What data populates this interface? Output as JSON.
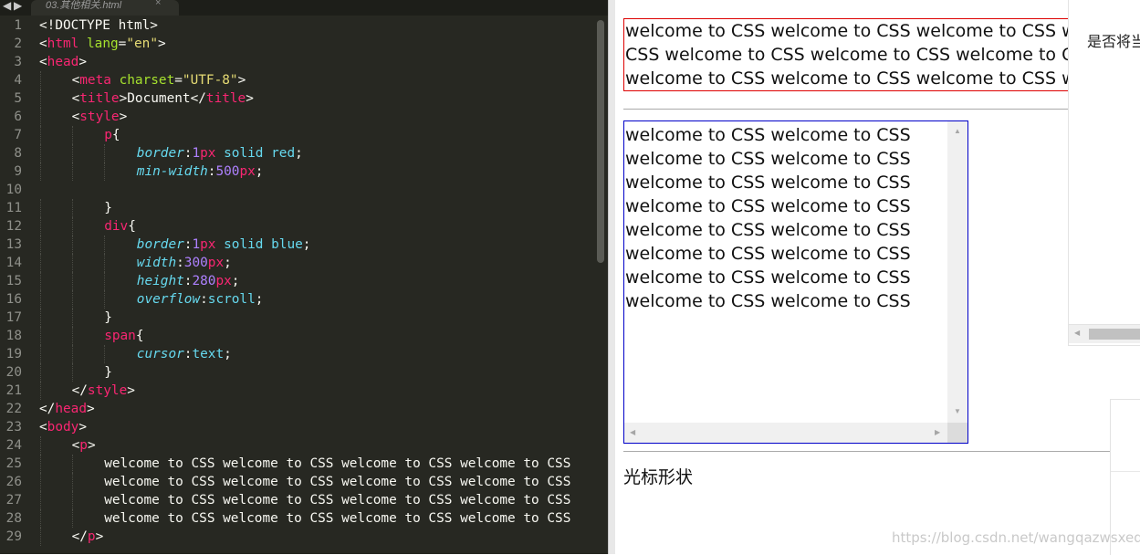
{
  "editor": {
    "tab": {
      "filename": "03.其他相关.html",
      "close_glyph": "×"
    },
    "nav": {
      "back": "◀",
      "forward": "▶"
    },
    "lines": [
      {
        "num": "1",
        "indent": 0,
        "tokens": [
          {
            "c": "x",
            "t": "<!DOCTYPE html>"
          }
        ]
      },
      {
        "num": "2",
        "indent": 0,
        "tokens": [
          {
            "c": "x",
            "t": "<"
          },
          {
            "c": "t",
            "t": "html"
          },
          {
            "c": "x",
            "t": " "
          },
          {
            "c": "a",
            "t": "lang"
          },
          {
            "c": "x",
            "t": "="
          },
          {
            "c": "s",
            "t": "\"en\""
          },
          {
            "c": "x",
            "t": ">"
          }
        ]
      },
      {
        "num": "3",
        "indent": 0,
        "tokens": [
          {
            "c": "x",
            "t": "<"
          },
          {
            "c": "t",
            "t": "head"
          },
          {
            "c": "x",
            "t": ">"
          }
        ]
      },
      {
        "num": "4",
        "indent": 1,
        "tokens": [
          {
            "c": "x",
            "t": "<"
          },
          {
            "c": "t",
            "t": "meta"
          },
          {
            "c": "x",
            "t": " "
          },
          {
            "c": "a",
            "t": "charset"
          },
          {
            "c": "x",
            "t": "="
          },
          {
            "c": "s",
            "t": "\"UTF-8\""
          },
          {
            "c": "x",
            "t": ">"
          }
        ]
      },
      {
        "num": "5",
        "indent": 1,
        "tokens": [
          {
            "c": "x",
            "t": "<"
          },
          {
            "c": "t",
            "t": "title"
          },
          {
            "c": "x",
            "t": ">Document</"
          },
          {
            "c": "t",
            "t": "title"
          },
          {
            "c": "x",
            "t": ">"
          }
        ]
      },
      {
        "num": "6",
        "indent": 1,
        "tokens": [
          {
            "c": "x",
            "t": "<"
          },
          {
            "c": "t",
            "t": "style"
          },
          {
            "c": "x",
            "t": ">"
          }
        ]
      },
      {
        "num": "7",
        "indent": 2,
        "tokens": [
          {
            "c": "t",
            "t": "p"
          },
          {
            "c": "x",
            "t": "{"
          }
        ]
      },
      {
        "num": "8",
        "indent": 3,
        "tokens": [
          {
            "c": "p",
            "t": "border"
          },
          {
            "c": "x",
            "t": ":"
          },
          {
            "c": "n",
            "t": "1"
          },
          {
            "c": "t",
            "t": "px"
          },
          {
            "c": "x",
            "t": " "
          },
          {
            "c": "v",
            "t": "solid"
          },
          {
            "c": "x",
            "t": " "
          },
          {
            "c": "v",
            "t": "red"
          },
          {
            "c": "x",
            "t": ";"
          }
        ]
      },
      {
        "num": "9",
        "indent": 3,
        "tokens": [
          {
            "c": "p",
            "t": "min-width"
          },
          {
            "c": "x",
            "t": ":"
          },
          {
            "c": "n",
            "t": "500"
          },
          {
            "c": "t",
            "t": "px"
          },
          {
            "c": "x",
            "t": ";"
          }
        ]
      },
      {
        "num": "10",
        "indent": 0,
        "tokens": []
      },
      {
        "num": "11",
        "indent": 2,
        "tokens": [
          {
            "c": "x",
            "t": "}"
          }
        ]
      },
      {
        "num": "12",
        "indent": 2,
        "tokens": [
          {
            "c": "t",
            "t": "div"
          },
          {
            "c": "x",
            "t": "{"
          }
        ]
      },
      {
        "num": "13",
        "indent": 3,
        "tokens": [
          {
            "c": "p",
            "t": "border"
          },
          {
            "c": "x",
            "t": ":"
          },
          {
            "c": "n",
            "t": "1"
          },
          {
            "c": "t",
            "t": "px"
          },
          {
            "c": "x",
            "t": " "
          },
          {
            "c": "v",
            "t": "solid"
          },
          {
            "c": "x",
            "t": " "
          },
          {
            "c": "v",
            "t": "blue"
          },
          {
            "c": "x",
            "t": ";"
          }
        ]
      },
      {
        "num": "14",
        "indent": 3,
        "tokens": [
          {
            "c": "p",
            "t": "width"
          },
          {
            "c": "x",
            "t": ":"
          },
          {
            "c": "n",
            "t": "300"
          },
          {
            "c": "t",
            "t": "px"
          },
          {
            "c": "x",
            "t": ";"
          }
        ]
      },
      {
        "num": "15",
        "indent": 3,
        "tokens": [
          {
            "c": "p",
            "t": "height"
          },
          {
            "c": "x",
            "t": ":"
          },
          {
            "c": "n",
            "t": "280"
          },
          {
            "c": "t",
            "t": "px"
          },
          {
            "c": "x",
            "t": ";"
          }
        ]
      },
      {
        "num": "16",
        "indent": 3,
        "tokens": [
          {
            "c": "p",
            "t": "overflow"
          },
          {
            "c": "x",
            "t": ":"
          },
          {
            "c": "v",
            "t": "scroll"
          },
          {
            "c": "x",
            "t": ";"
          }
        ]
      },
      {
        "num": "17",
        "indent": 2,
        "tokens": [
          {
            "c": "x",
            "t": "}"
          }
        ]
      },
      {
        "num": "18",
        "indent": 2,
        "tokens": [
          {
            "c": "t",
            "t": "span"
          },
          {
            "c": "x",
            "t": "{"
          }
        ]
      },
      {
        "num": "19",
        "indent": 3,
        "tokens": [
          {
            "c": "p",
            "t": "cursor"
          },
          {
            "c": "x",
            "t": ":"
          },
          {
            "c": "v",
            "t": "text"
          },
          {
            "c": "x",
            "t": ";"
          }
        ]
      },
      {
        "num": "20",
        "indent": 2,
        "tokens": [
          {
            "c": "x",
            "t": "}"
          }
        ]
      },
      {
        "num": "21",
        "indent": 1,
        "tokens": [
          {
            "c": "x",
            "t": "</"
          },
          {
            "c": "t",
            "t": "style"
          },
          {
            "c": "x",
            "t": ">"
          }
        ]
      },
      {
        "num": "22",
        "indent": 0,
        "tokens": [
          {
            "c": "x",
            "t": "</"
          },
          {
            "c": "t",
            "t": "head"
          },
          {
            "c": "x",
            "t": ">"
          }
        ]
      },
      {
        "num": "23",
        "indent": 0,
        "tokens": [
          {
            "c": "x",
            "t": "<"
          },
          {
            "c": "t",
            "t": "body"
          },
          {
            "c": "x",
            "t": ">"
          }
        ]
      },
      {
        "num": "24",
        "indent": 1,
        "tokens": [
          {
            "c": "x",
            "t": "<"
          },
          {
            "c": "t",
            "t": "p"
          },
          {
            "c": "x",
            "t": ">"
          }
        ]
      },
      {
        "num": "25",
        "indent": 2,
        "tokens": [
          {
            "c": "x",
            "t": "welcome to CSS welcome to CSS welcome to CSS welcome to CSS"
          }
        ]
      },
      {
        "num": "26",
        "indent": 2,
        "tokens": [
          {
            "c": "x",
            "t": "welcome to CSS welcome to CSS welcome to CSS welcome to CSS"
          }
        ]
      },
      {
        "num": "27",
        "indent": 2,
        "tokens": [
          {
            "c": "x",
            "t": "welcome to CSS welcome to CSS welcome to CSS welcome to CSS"
          }
        ]
      },
      {
        "num": "28",
        "indent": 2,
        "tokens": [
          {
            "c": "x",
            "t": "welcome to CSS welcome to CSS welcome to CSS welcome to CSS"
          }
        ]
      },
      {
        "num": "29",
        "indent": 1,
        "tokens": [
          {
            "c": "x",
            "t": "</"
          },
          {
            "c": "t",
            "t": "p"
          },
          {
            "c": "x",
            "t": ">"
          }
        ]
      }
    ]
  },
  "preview": {
    "red_paragraph_lines": [
      "welcome to CSS welcome to CSS welcome to CSS welcome to CSS",
      "CSS welcome to CSS welcome to CSS welcome to CSS welcome to CSS",
      "welcome to CSS welcome to CSS welcome to CSS welcome to CSS"
    ],
    "blue_div_lines": [
      "welcome to CSS welcome to CSS",
      "welcome to CSS welcome to CSS",
      "welcome to CSS welcome to CSS",
      "welcome to CSS welcome to CSS",
      "welcome to CSS welcome to CSS",
      "welcome to CSS welcome to CSS",
      "welcome to CSS welcome to CSS",
      "welcome to CSS welcome to CSS"
    ],
    "cursor_label": "光标形状",
    "scroll_up": "▲",
    "scroll_down": "▼",
    "scroll_left": "◀",
    "scroll_right": "▶"
  },
  "overlay": {
    "text": "是否将当前"
  },
  "watermark": "https://blog.csdn.net/wangqazwsxedc",
  "colors": {
    "editor_bg": "#272822",
    "tag": "#f92672",
    "attr": "#a6e22e",
    "string": "#e6db74",
    "property": "#66d9ef",
    "number": "#ae81ff",
    "red_border": "#dd0000",
    "blue_border": "#0000c8"
  }
}
